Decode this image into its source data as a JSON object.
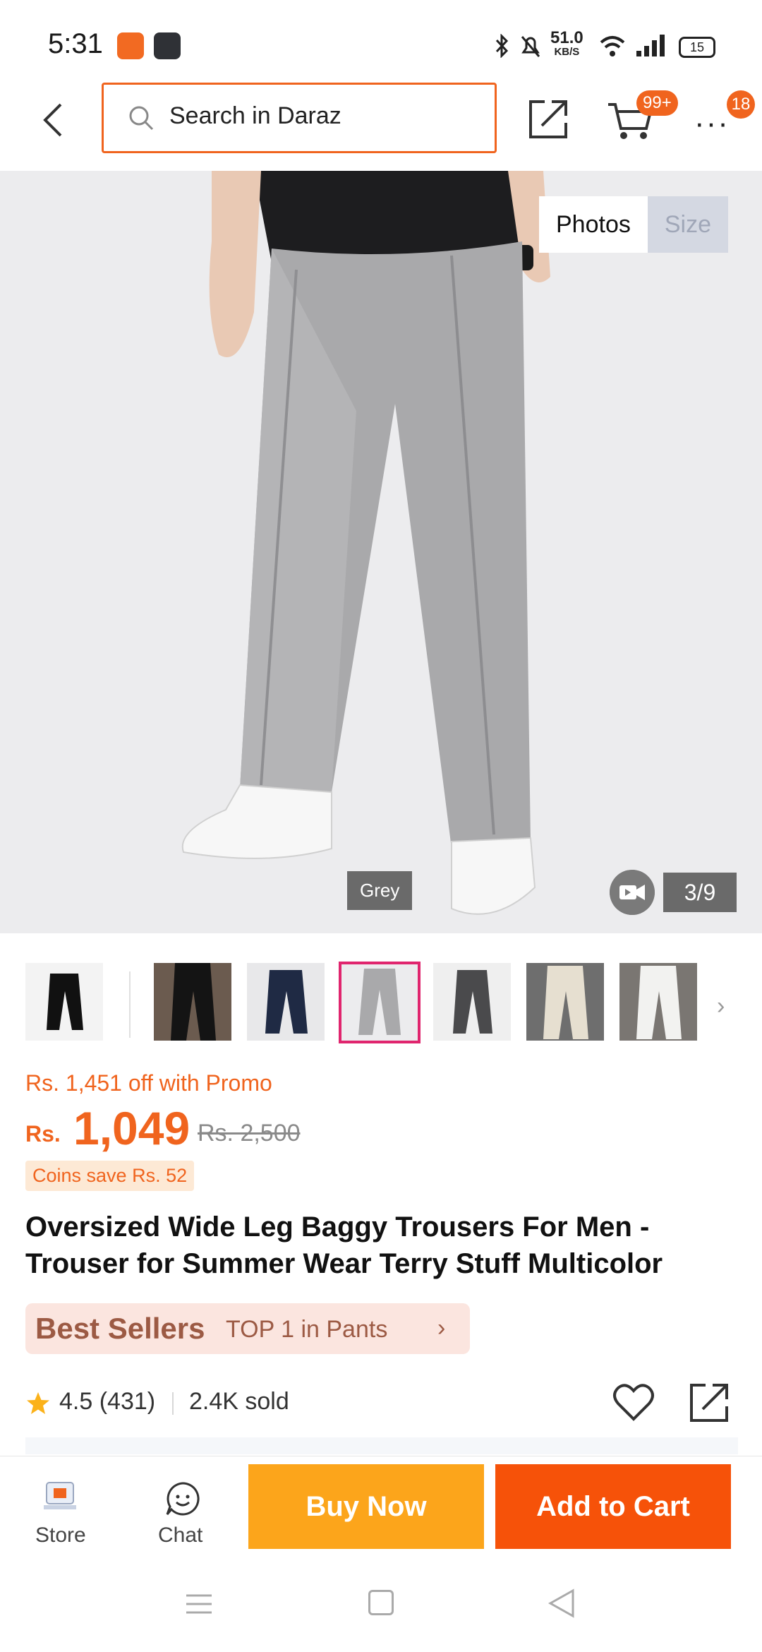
{
  "status": {
    "time": "5:31",
    "net_speed": "51.0",
    "net_unit": "KB/S",
    "battery": "15"
  },
  "header": {
    "search_placeholder": "Search in Daraz",
    "cart_badge": "99+",
    "more_badge": "18"
  },
  "gallery": {
    "tabs": [
      {
        "label": "Photos",
        "active": true
      },
      {
        "label": "Size",
        "active": false
      }
    ],
    "color_tag": "Grey",
    "counter": "3/9"
  },
  "thumbnails": [
    {
      "color": "black",
      "selected": false
    },
    {
      "color": "black",
      "selected": false
    },
    {
      "color": "navy",
      "selected": false
    },
    {
      "color": "grey",
      "selected": true
    },
    {
      "color": "dark-grey",
      "selected": false
    },
    {
      "color": "beige",
      "selected": false
    },
    {
      "color": "white",
      "selected": false
    }
  ],
  "price": {
    "promo": "Rs. 1,451 off with Promo",
    "currency": "Rs.",
    "current": "1,049",
    "original": "Rs. 2,500",
    "coins": "Coins save Rs. 52"
  },
  "product": {
    "title": "Oversized Wide Leg Baggy Trousers For Men - Trouser for Summer Wear Terry Stuff Multicolor"
  },
  "best_sellers": {
    "label": "Best Sellers",
    "rank": "TOP 1 in Pants"
  },
  "rating": {
    "text": "4.5 (431)",
    "sold": "2.4K sold"
  },
  "bottom": {
    "store": "Store",
    "chat": "Chat",
    "buy_now": "Buy Now",
    "add_to_cart": "Add to Cart"
  },
  "colors": {
    "accent": "#f0641e",
    "buy": "#fca51b",
    "cart": "#f65209"
  }
}
